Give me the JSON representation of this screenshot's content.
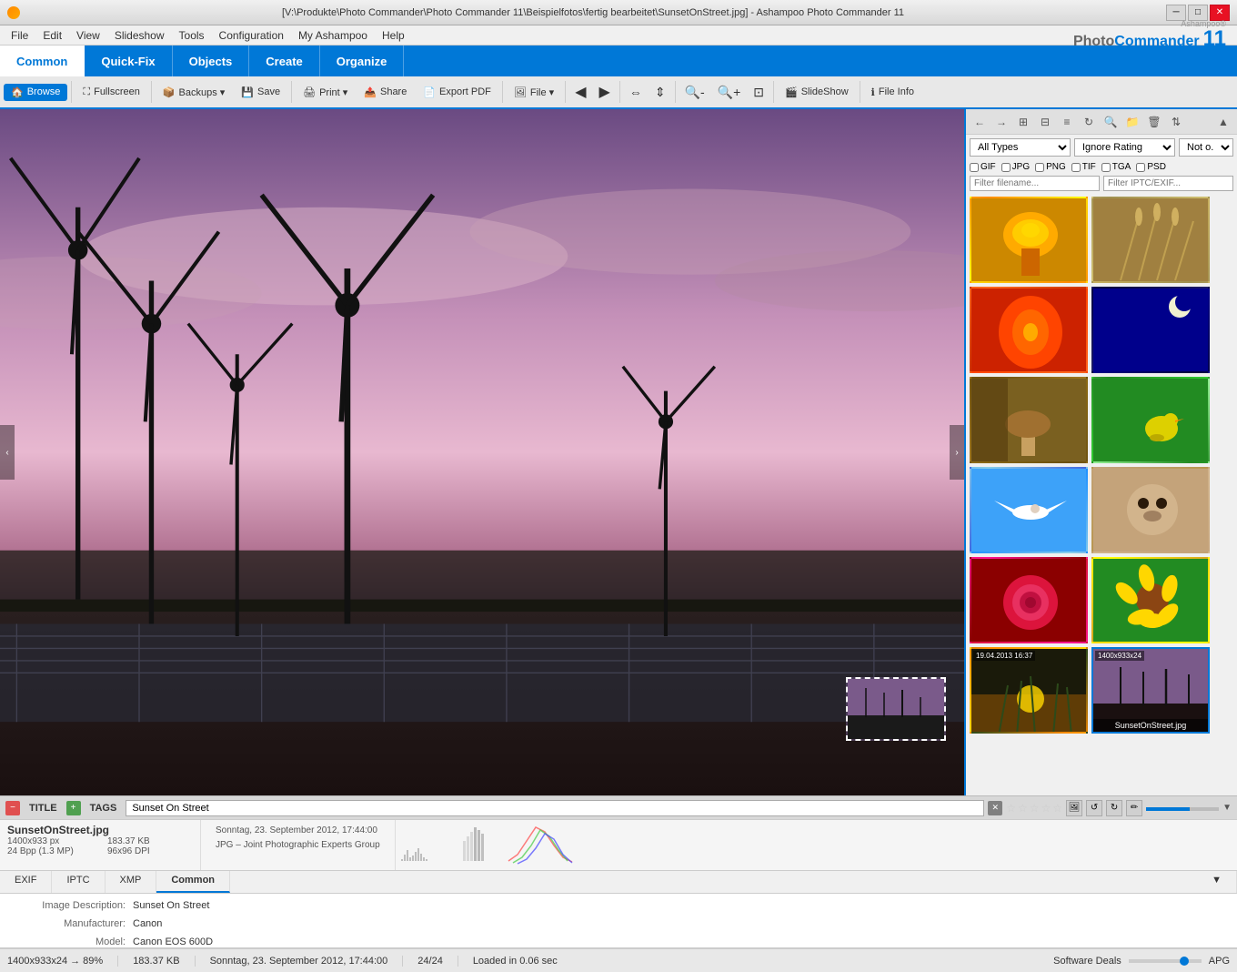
{
  "titlebar": {
    "title": "[V:\\Produkte\\Photo Commander\\Photo Commander 11\\Beispielfotos\\fertig bearbeitet\\SunsetOnStreet.jpg] - Ashampoo Photo Commander 11",
    "min_label": "─",
    "max_label": "□",
    "close_label": "✕"
  },
  "menubar": {
    "items": [
      "File",
      "Edit",
      "View",
      "Slideshow",
      "Tools",
      "Configuration",
      "My Ashampoo",
      "Help"
    ]
  },
  "tabs": {
    "items": [
      "Common",
      "Quick-Fix",
      "Objects",
      "Create",
      "Organize"
    ],
    "active": "Common"
  },
  "toolbar": {
    "items": [
      {
        "id": "browse",
        "label": "Browse",
        "icon": "🏠",
        "active": true
      },
      {
        "id": "fullscreen",
        "label": "Fullscreen",
        "icon": "⛶"
      },
      {
        "id": "backups",
        "label": "Backups ▾",
        "icon": "📦"
      },
      {
        "id": "save",
        "label": "Save",
        "icon": "💾"
      },
      {
        "id": "print",
        "label": "Print ▾",
        "icon": "🖨"
      },
      {
        "id": "share",
        "label": "Share",
        "icon": "📤"
      },
      {
        "id": "export-pdf",
        "label": "Export PDF",
        "icon": "📄"
      },
      {
        "id": "file",
        "label": "File ▾",
        "icon": "🖼"
      },
      {
        "id": "back",
        "label": "",
        "icon": "◀"
      },
      {
        "id": "forward",
        "label": "",
        "icon": "▶"
      },
      {
        "id": "flip-h",
        "label": "",
        "icon": "↔"
      },
      {
        "id": "flip-v",
        "label": "",
        "icon": "↕"
      },
      {
        "id": "zoom-out",
        "label": "",
        "icon": "🔍"
      },
      {
        "id": "zoom-in",
        "label": "",
        "icon": "🔍"
      },
      {
        "id": "zoom-fit",
        "label": "",
        "icon": "⊡"
      },
      {
        "id": "slideshow",
        "label": "SlideShow",
        "icon": "🎬"
      },
      {
        "id": "file-info",
        "label": "File Info",
        "icon": "ℹ"
      }
    ]
  },
  "brand": {
    "ashampoo": "Ashampoo®",
    "photo": "Photo",
    "commander": "Commander",
    "number": "11"
  },
  "image": {
    "title": "Sunset On Street",
    "filename": "SunsetOnStreet.jpg"
  },
  "info_bar": {
    "title_label": "TITLE",
    "tags_label": "TAGS",
    "image_title": "Sunset On Street",
    "close_symbol": "✕",
    "stars": [
      "☆",
      "☆",
      "☆",
      "☆",
      "☆"
    ]
  },
  "file_strip": {
    "filename": "SunsetOnStreet.jpg",
    "dimensions": "1400x933 px",
    "bits": "24 Bpp (1.3 MP)",
    "filesize": "183.37 KB",
    "dpi": "96x96 DPI",
    "date": "Sonntag, 23. September 2012, 17:44:00",
    "format": "JPG – Joint Photographic Experts Group"
  },
  "meta_tabs": {
    "items": [
      "EXIF",
      "IPTC",
      "XMP",
      "Common"
    ],
    "active": "Common"
  },
  "meta_fields": [
    {
      "key": "Image Description:",
      "value": "Sunset On Street"
    },
    {
      "key": "Manufacturer:",
      "value": "Canon"
    },
    {
      "key": "Model:",
      "value": "Canon EOS 600D"
    }
  ],
  "right_panel": {
    "filter_options": [
      "All Types",
      "Ignore Rating",
      "Not o..."
    ],
    "file_types": [
      "GIF",
      "JPG",
      "PNG",
      "TIF",
      "TGA",
      "PSD"
    ],
    "filter_filename_placeholder": "Filter filename...",
    "filter_exif_placeholder": "Filter IPTC/EXIF..."
  },
  "thumbnails": [
    {
      "id": "bee",
      "class": "thumb-bee",
      "label": ""
    },
    {
      "id": "grain",
      "class": "thumb-grain",
      "label": ""
    },
    {
      "id": "flower",
      "class": "thumb-flower",
      "label": ""
    },
    {
      "id": "moon",
      "class": "thumb-moon",
      "label": ""
    },
    {
      "id": "mushroom",
      "class": "thumb-mushroom",
      "label": ""
    },
    {
      "id": "yellow-bird",
      "class": "thumb-bird2",
      "label": ""
    },
    {
      "id": "bird-flight",
      "class": "thumb-bird",
      "label": ""
    },
    {
      "id": "dog",
      "class": "thumb-dog",
      "label": ""
    },
    {
      "id": "rose",
      "class": "thumb-rose",
      "label": ""
    },
    {
      "id": "sunflower",
      "class": "thumb-sunflower",
      "label": ""
    },
    {
      "id": "grass-sunset",
      "class": "thumb-grass",
      "label": "",
      "date": "19.04.2013 16:37"
    },
    {
      "id": "windmill-street",
      "class": "thumb-windmill",
      "label": "SunsetOnStreet.jpg",
      "date": "1400x933x24",
      "selected": true
    }
  ],
  "statusbar": {
    "dimensions": "1400x933x24 → 89%",
    "filesize": "183.37 KB",
    "date": "Sonntag, 23. September 2012, 17:44:00",
    "count": "24/24",
    "load_time": "Loaded in 0.06 sec",
    "software": "Software Deals",
    "app": "APG"
  }
}
